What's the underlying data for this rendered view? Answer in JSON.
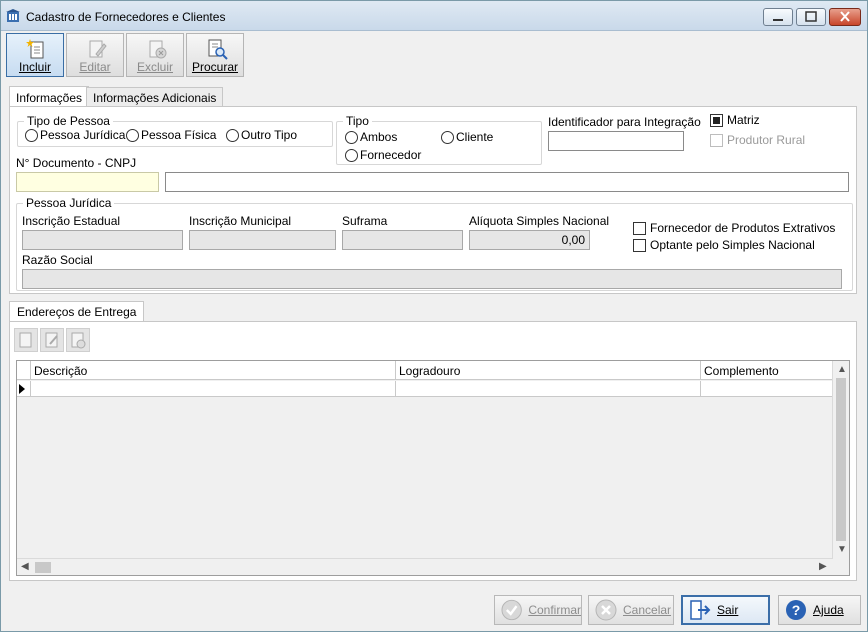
{
  "window": {
    "title": "Cadastro de Fornecedores e Clientes"
  },
  "toolbar": {
    "incluir": "Incluir",
    "editar": "Editar",
    "excluir": "Excluir",
    "procurar": "Procurar"
  },
  "tabs": {
    "informacoes": "Informações",
    "informacoes_adicionais": "Informações Adicionais"
  },
  "tipo_pessoa": {
    "title": "Tipo de Pessoa",
    "options": [
      "Pessoa Jurídica",
      "Pessoa Física",
      "Outro Tipo"
    ]
  },
  "tipo": {
    "title": "Tipo",
    "options": [
      "Ambos",
      "Cliente",
      "Fornecedor"
    ]
  },
  "identificador": {
    "label": "Identificador para Integração",
    "value": ""
  },
  "matriz": {
    "label": "Matriz",
    "checked": true
  },
  "produtor_rural": {
    "label": "Produtor Rural",
    "checked": false,
    "disabled": true
  },
  "documento": {
    "label": "N° Documento - CNPJ",
    "value": "",
    "name_value": ""
  },
  "pessoa_juridica": {
    "title": "Pessoa Jurídica",
    "inscricao_estadual": "Inscrição Estadual",
    "inscricao_municipal": "Inscrição Municipal",
    "suframa": "Suframa",
    "aliquota_label": "Alíquota Simples Nacional",
    "aliquota_value": "0,00",
    "razao_social": "Razão Social",
    "fornecedor_extrativos": "Fornecedor de Produtos Extrativos",
    "optante_simples": "Optante pelo Simples Nacional"
  },
  "enderecos": {
    "tab": "Endereços de Entrega",
    "columns": [
      "Descrição",
      "Logradouro",
      "Complemento"
    ]
  },
  "buttons": {
    "confirmar": "Confirmar",
    "cancelar": "Cancelar",
    "sair": "Sair",
    "ajuda": "Ajuda"
  },
  "colors": {
    "accent": "#3b6ea8",
    "yellow_field": "#ffffe1",
    "help_blue": "#2a62b4"
  }
}
